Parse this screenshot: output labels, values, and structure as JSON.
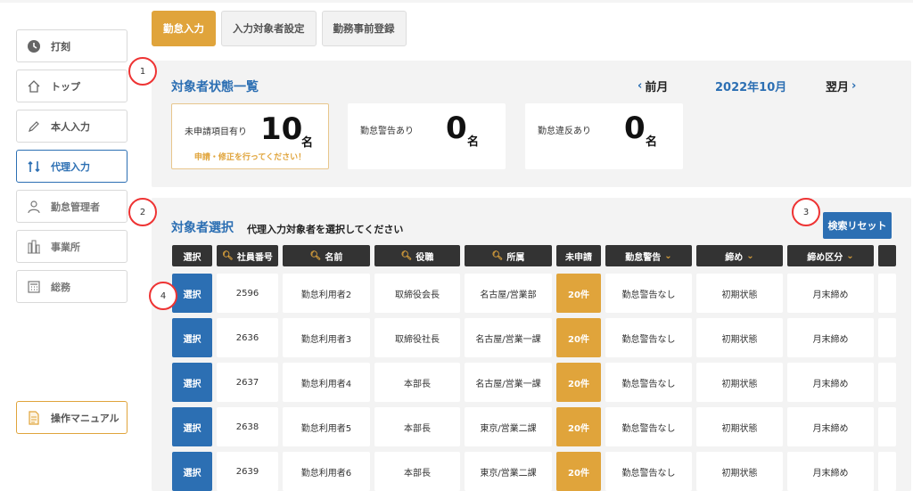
{
  "tabs": [
    {
      "label": "勤怠入力",
      "active": true
    },
    {
      "label": "入力対象者設定",
      "active": false
    },
    {
      "label": "勤務事前登録",
      "active": false
    }
  ],
  "sidebar": {
    "items": [
      {
        "label": "打刻",
        "icon": "clock-icon"
      },
      {
        "label": "トップ",
        "icon": "home-icon"
      },
      {
        "label": "本人入力",
        "icon": "pencil-icon"
      },
      {
        "label": "代理入力",
        "icon": "swap-icon"
      },
      {
        "label": "勤怠管理者",
        "icon": "person-icon"
      },
      {
        "label": "事業所",
        "icon": "building-icon"
      },
      {
        "label": "総務",
        "icon": "calculator-icon"
      }
    ],
    "manual_label": "操作マニュアル"
  },
  "status": {
    "title": "対象者状態一覧",
    "prev_month": "前月",
    "current_month": "2022年10月",
    "next_month": "翌月",
    "cards": [
      {
        "label": "未申請項目有り",
        "value": "10",
        "unit": "名",
        "note": "申請・修正を行ってください！"
      },
      {
        "label": "勤怠警告あり",
        "value": "0",
        "unit": "名"
      },
      {
        "label": "勤怠違反あり",
        "value": "0",
        "unit": "名"
      }
    ]
  },
  "selection": {
    "title": "対象者選択",
    "description": "代理入力対象者を選択してください",
    "reset_label": "検索リセット",
    "columns": [
      "選択",
      "社員番号",
      "名前",
      "役職",
      "所属",
      "未申請",
      "勤怠警告",
      "締め",
      "締め区分"
    ],
    "rows": [
      {
        "select": "選択",
        "id": "2596",
        "name": "勤怠利用者2",
        "title": "取締役会長",
        "dept": "名古屋/営業部",
        "pending": "20件",
        "warning": "勤怠警告なし",
        "closing": "初期状態",
        "closing_type": "月末締め"
      },
      {
        "select": "選択",
        "id": "2636",
        "name": "勤怠利用者3",
        "title": "取締役社長",
        "dept": "名古屋/営業一課",
        "pending": "20件",
        "warning": "勤怠警告なし",
        "closing": "初期状態",
        "closing_type": "月末締め"
      },
      {
        "select": "選択",
        "id": "2637",
        "name": "勤怠利用者4",
        "title": "本部長",
        "dept": "名古屋/営業一課",
        "pending": "20件",
        "warning": "勤怠警告なし",
        "closing": "初期状態",
        "closing_type": "月末締め"
      },
      {
        "select": "選択",
        "id": "2638",
        "name": "勤怠利用者5",
        "title": "本部長",
        "dept": "東京/営業二課",
        "pending": "20件",
        "warning": "勤怠警告なし",
        "closing": "初期状態",
        "closing_type": "月末締め"
      },
      {
        "select": "選択",
        "id": "2639",
        "name": "勤怠利用者6",
        "title": "本部長",
        "dept": "東京/営業二課",
        "pending": "20件",
        "warning": "勤怠警告なし",
        "closing": "初期状態",
        "closing_type": "月末締め"
      }
    ]
  },
  "markers": [
    "1",
    "2",
    "3",
    "4"
  ],
  "colors": {
    "accent": "#e0a43b",
    "primary": "#2c6fb3",
    "header": "#333333",
    "marker": "#ee3333"
  }
}
